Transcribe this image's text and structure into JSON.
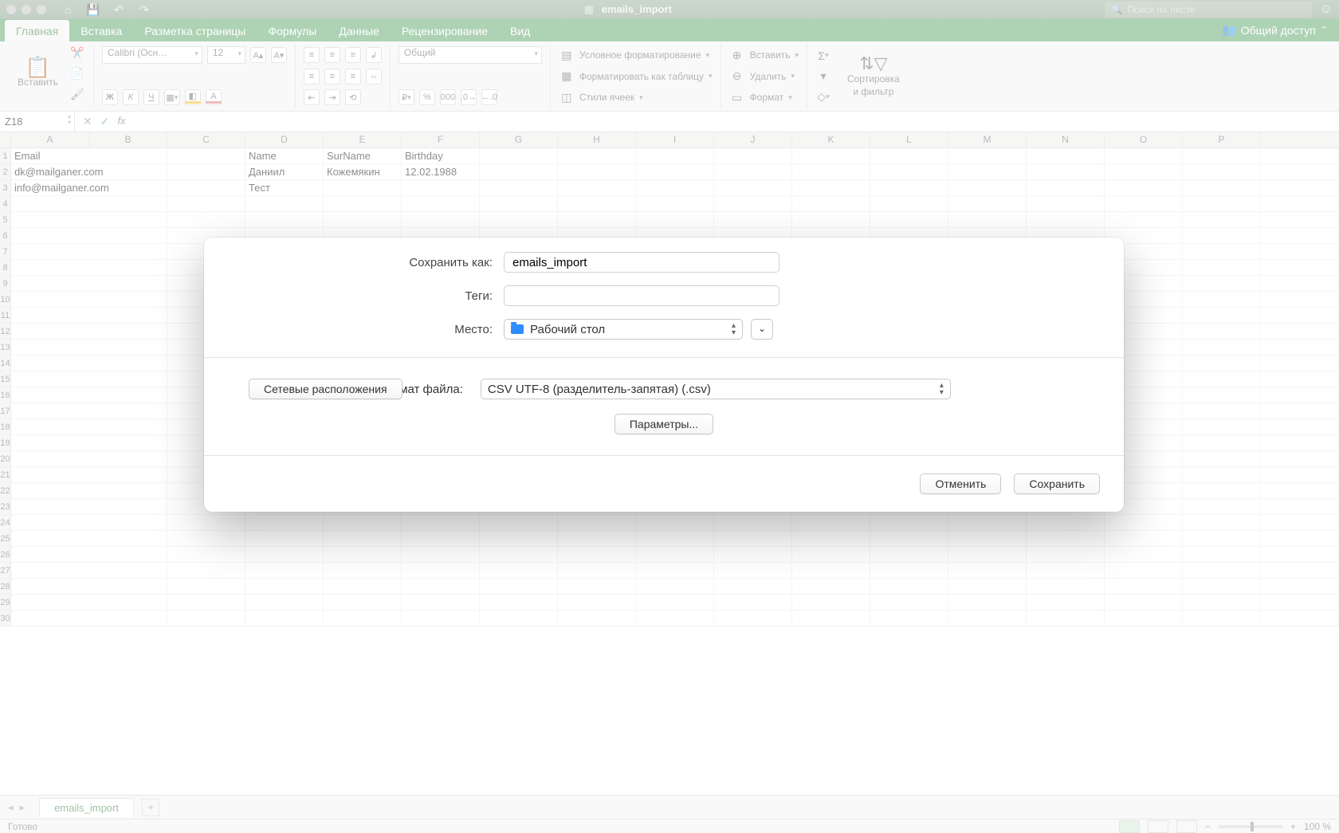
{
  "titlebar": {
    "doc_title": "emails_import",
    "search_placeholder": "Поиск на листе"
  },
  "tabs": {
    "items": [
      "Главная",
      "Вставка",
      "Разметка страницы",
      "Формулы",
      "Данные",
      "Рецензирование",
      "Вид"
    ],
    "active_index": 0,
    "share": "Общий доступ"
  },
  "ribbon": {
    "paste": "Вставить",
    "font_name": "Calibri (Осн…",
    "font_size": "12",
    "number_format": "Общий",
    "cond_format": "Условное форматирование",
    "as_table": "Форматировать как таблицу",
    "cell_styles": "Стили ячеек",
    "insert": "Вставить",
    "delete": "Удалить",
    "format": "Формат",
    "sort_filter_l1": "Сортировка",
    "sort_filter_l2": "и фильтр"
  },
  "formula": {
    "name_box": "Z18"
  },
  "grid": {
    "columns": [
      "A",
      "B",
      "C",
      "D",
      "E",
      "F",
      "G",
      "H",
      "I",
      "J",
      "K",
      "L",
      "M",
      "N",
      "O",
      "P"
    ],
    "rows": [
      {
        "A": "Email",
        "B": "",
        "C": "Name",
        "D": "SurName",
        "E": "Birthday"
      },
      {
        "A": "dk@mailganer.com",
        "B": "",
        "C": "Даниил",
        "D": "Кожемякин",
        "E": "12.02.1988"
      },
      {
        "A": "info@mailganer.com",
        "B": "",
        "C": "Тест"
      }
    ],
    "row_count_visible": 30
  },
  "sheet": {
    "name": "emails_import"
  },
  "status": {
    "ready": "Готово",
    "zoom": "100 %"
  },
  "dialog": {
    "save_as_label": "Сохранить как:",
    "save_as_value": "emails_import",
    "tags_label": "Теги:",
    "tags_value": "",
    "where_label": "Место:",
    "where_value": "Рабочий стол",
    "network_locations": "Сетевые расположения",
    "format_label": "Формат файла:",
    "format_value": "CSV UTF-8 (разделитель-запятая) (.csv)",
    "options": "Параметры...",
    "cancel": "Отменить",
    "save": "Сохранить"
  }
}
